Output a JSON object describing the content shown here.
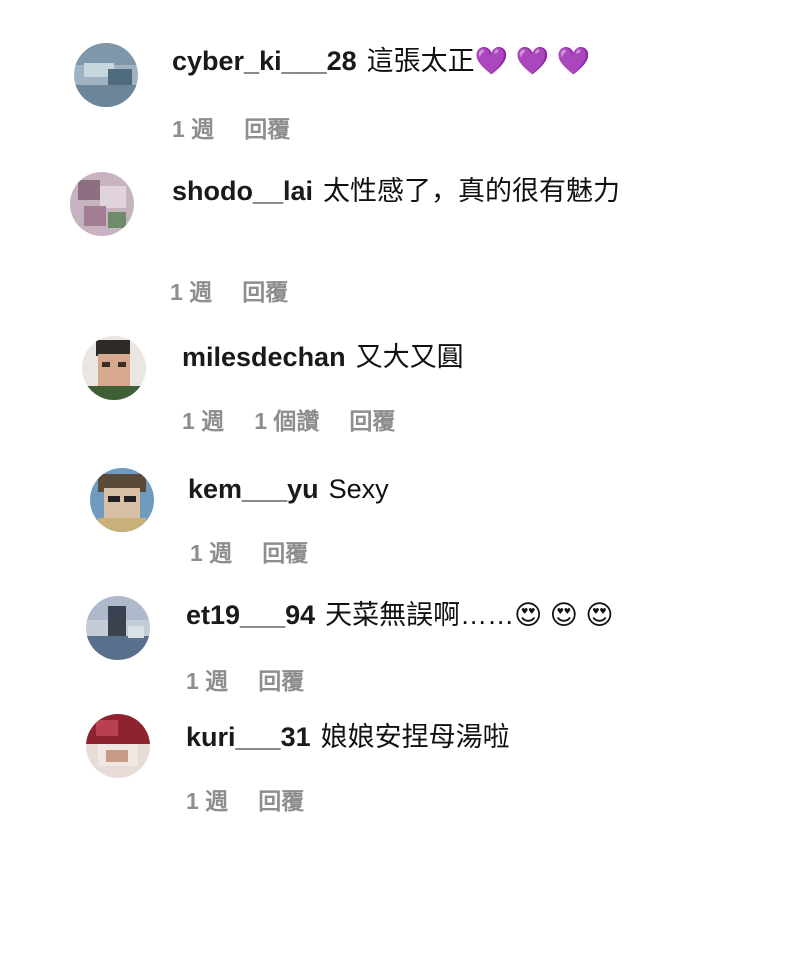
{
  "comments": [
    {
      "username": "cyber_ki___28",
      "text": "這張太正💜 💜 💜",
      "time": "1 週",
      "likes": "",
      "reply": "回覆"
    },
    {
      "username": "shodo__lai",
      "text": "太性感了，真的很有魅力",
      "time": "1 週",
      "likes": "",
      "reply": "回覆"
    },
    {
      "username": "milesdechan",
      "text": "又大又圓",
      "time": "1 週",
      "likes": "1 個讚",
      "reply": "回覆"
    },
    {
      "username": "kem___yu",
      "text": "Sexy",
      "time": "1 週",
      "likes": "",
      "reply": "回覆"
    },
    {
      "username": "et19___94",
      "text": "天菜無誤啊……😍 😍 😍",
      "time": "1 週",
      "likes": "",
      "reply": "回覆"
    },
    {
      "username": "kuri___31",
      "text": "娘娘安捏母湯啦",
      "time": "1 週",
      "likes": "",
      "reply": "回覆"
    }
  ],
  "colors": {
    "meta": "#8e8e8e",
    "text": "#111111"
  }
}
